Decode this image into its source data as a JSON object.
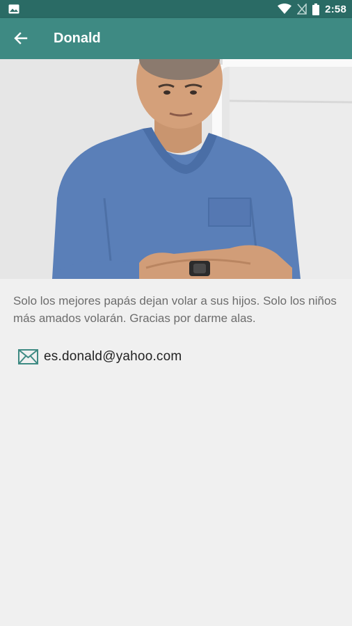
{
  "status_bar": {
    "time": "2:58",
    "icons": [
      "gallery-icon",
      "wifi-icon",
      "no-signal-icon",
      "battery-icon"
    ]
  },
  "app_bar": {
    "title": "Donald",
    "back_icon": "arrow-left-icon"
  },
  "colors": {
    "status_bar": "#2a6b65",
    "app_bar": "#3e8a83",
    "background": "#f0f0f0",
    "accent_icon": "#3e8a83"
  },
  "profile": {
    "photo_alt": "profile-photo",
    "description": "Solo los mejores papás dejan volar a sus hijos. Solo los niños más amados volarán. Gracias por darme alas.",
    "contact": {
      "icon": "mail-icon",
      "email": "es.donald@yahoo.com"
    }
  }
}
